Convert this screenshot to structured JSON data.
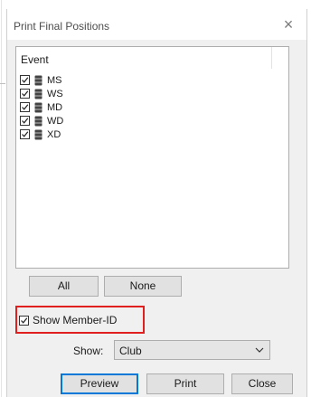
{
  "window": {
    "title": "Print Final Positions",
    "close_glyph": "×"
  },
  "events_list": {
    "header": "Event",
    "items": [
      {
        "label": "MS",
        "checked": true,
        "icon": "database-icon"
      },
      {
        "label": "WS",
        "checked": true,
        "icon": "database-icon"
      },
      {
        "label": "MD",
        "checked": true,
        "icon": "database-icon"
      },
      {
        "label": "WD",
        "checked": true,
        "icon": "database-icon"
      },
      {
        "label": "XD",
        "checked": true,
        "icon": "database-icon"
      }
    ]
  },
  "selection_buttons": {
    "all_label": "All",
    "none_label": "None"
  },
  "options": {
    "show_member_id_label": "Show Member-ID",
    "show_member_id_checked": true,
    "highlight_color": "#e01f1f",
    "show_label": "Show:",
    "show_value": "Club"
  },
  "footer": {
    "preview_label": "Preview",
    "print_label": "Print",
    "close_label": "Close"
  },
  "colors": {
    "dialog_bg": "#f0f0f0",
    "button_bg": "#e1e1e1",
    "default_button_border": "#0078d7"
  }
}
